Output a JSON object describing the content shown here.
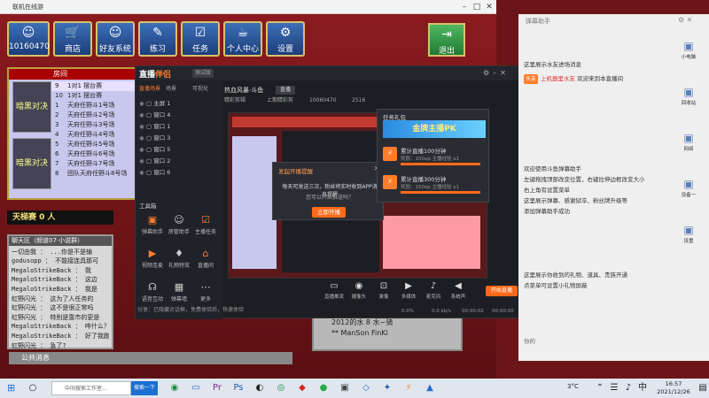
{
  "game": {
    "title": "联机在线游",
    "top_icons": [
      {
        "label": "商店",
        "icon": "cart-icon"
      },
      {
        "label": "好友系统",
        "icon": "friends-icon"
      },
      {
        "label": "练习",
        "icon": "practice-icon"
      },
      {
        "label": "任务",
        "icon": "task-icon"
      },
      {
        "label": "个人中心",
        "icon": "profile-icon"
      },
      {
        "label": "设置",
        "icon": "gear-icon"
      }
    ],
    "user_id": "10160470",
    "exit_label": "退出",
    "roomlist_header": "房间",
    "room_rows": [
      {
        "num": "9",
        "name": "1对1 摆台赛"
      },
      {
        "num": "10",
        "name": "1对1 摆台赛"
      },
      {
        "num": "1",
        "name": "天府任野斗1号场"
      },
      {
        "num": "2",
        "name": "天府任野斗2号场"
      },
      {
        "num": "3",
        "name": "天府任野斗3号场"
      },
      {
        "num": "4",
        "name": "天府任野斗4号场"
      },
      {
        "num": "5",
        "name": "天府任野斗5号场"
      },
      {
        "num": "6",
        "name": "天府任野斗6号场"
      },
      {
        "num": "7",
        "name": "天府任野斗7号场"
      },
      {
        "num": "8",
        "name": "团队天府任野斗8号场"
      }
    ],
    "card1": "暗黑对决",
    "card2": "暗黑对决",
    "tag_label": "天梯赛",
    "tag_count": "0 人",
    "chat_title": "聊天区（频道07·小说群）",
    "chat_lines": [
      "一切由我 ： ...你是不是输",
      "godusopp ： 不能接连具那可",
      "MegaloStrikeBack ： 我",
      "MegaloStrikeBack ： 这边",
      "MegaloStrikeBack ： 我是",
      "虹野闪光 ： 这为了人任务的",
      "虹野闪光 ： 这不是很正常吗",
      "虹野闪光 ： 特别是靠市的更是",
      "MegaloStrikeBack ： 哗什么？",
      "MegaloStrikeBack ： 好了我跑去了辉？",
      "虹野闪光 ： 急了?"
    ],
    "public_msg_label": "公共消息",
    "right_items": [
      "2012的水 8 水~骑",
      "** ManSon FinKi"
    ]
  },
  "app": {
    "logo_a": "直播",
    "logo_b": "伴侣",
    "version": "测试版",
    "left_tabs": [
      "直播场景",
      "场景",
      "可视化"
    ],
    "scenes": [
      "主屏 1",
      "窗口 4",
      "窗口 1",
      "窗口 3",
      "窗口 5",
      "窗口 2",
      "窗口 6"
    ],
    "toolbox_label": "工具箱",
    "tools": [
      {
        "label": "弹幕助手",
        "icon": "danmaku-icon",
        "orange": true
      },
      {
        "label": "房管助手",
        "icon": "manager-icon",
        "orange": false
      },
      {
        "label": "主播任务",
        "icon": "task-icon",
        "orange": true
      },
      {
        "label": "视频连麦",
        "icon": "video-icon",
        "orange": true
      },
      {
        "label": "礼物特效",
        "icon": "gift-icon",
        "orange": false
      },
      {
        "label": "直播间",
        "icon": "room-icon",
        "orange": true
      },
      {
        "label": "语音互动",
        "icon": "voice-icon",
        "orange": false
      },
      {
        "label": "弹幕墙",
        "icon": "wall-icon",
        "orange": false
      },
      {
        "label": "更多",
        "icon": "more-icon",
        "orange": false
      }
    ],
    "notice": "分享：已隐藏对话框，免费体验后，快速体验",
    "room_title": "热血风暴·斗鱼",
    "room_badge": "直播",
    "subtabs": [
      "精彩剪辑",
      "上期精彩剪",
      "10060470",
      "2516"
    ],
    "dialog": {
      "title": "发起开播提醒",
      "text": "每天可发送三次，粉丝将实时收到APP消息提醒",
      "text2": "您可以开启推送吗？",
      "button": "立即开播"
    },
    "gifts": {
      "title": "任务礼包",
      "banner": "金牌主播PK",
      "items": [
        {
          "title": "累计直播100分钟",
          "sub": "奖励：100xp 主播经验 x1"
        },
        {
          "title": "累计直播300分钟",
          "sub": "奖励：150xp 主播经验 x1"
        }
      ]
    },
    "controls": [
      {
        "label": "直播推流",
        "icon": "stream-icon"
      },
      {
        "label": "摄像头",
        "icon": "camera-icon"
      },
      {
        "label": "录像",
        "icon": "record-icon"
      },
      {
        "label": "多媒体",
        "icon": "media-icon"
      },
      {
        "label": "麦克风",
        "icon": "mic-icon"
      },
      {
        "label": "系统声",
        "icon": "speaker-icon"
      }
    ],
    "go_live": "开始直播",
    "stats": [
      "0.0%",
      "0.0 kb/s",
      "00:00:02",
      "00:00:00"
    ]
  },
  "helper": {
    "title": "弹幕助手",
    "lines": [
      {
        "text": "这里展示水友进场消息",
        "style": "normal"
      },
      {
        "text": "欢迎来到本直播间",
        "style": "badge",
        "badge": "水友",
        "prefix": "上机器里水友"
      },
      {
        "text": "欢迎使用斗鱼弹幕助手",
        "style": "normal"
      },
      {
        "text": "左键拖拽顶部改变位置，右键拉伸边框改变大小",
        "style": "normal"
      },
      {
        "text": "右上角有设置菜单",
        "style": "normal"
      },
      {
        "text": "这里展示弹幕、感谢狱卒、粉丝牌升级等",
        "style": "normal"
      },
      {
        "text": "添加弹幕助手成功",
        "style": "normal"
      },
      {
        "text": "这里展示你收到的礼物、道具、贵族开通",
        "style": "normal"
      },
      {
        "text": "点菜单可设置小礼物屏蔽",
        "style": "normal"
      }
    ],
    "bottom": "你的",
    "desk_icons": [
      "小电脑",
      "回收站",
      "网络",
      "设备一",
      "设置"
    ]
  },
  "taskbar": {
    "search_placeholder": "中间搜索工作室...",
    "search_button": "搜索一下",
    "temperature": "3°C",
    "time": "16:57",
    "date": "2021/12/26"
  }
}
